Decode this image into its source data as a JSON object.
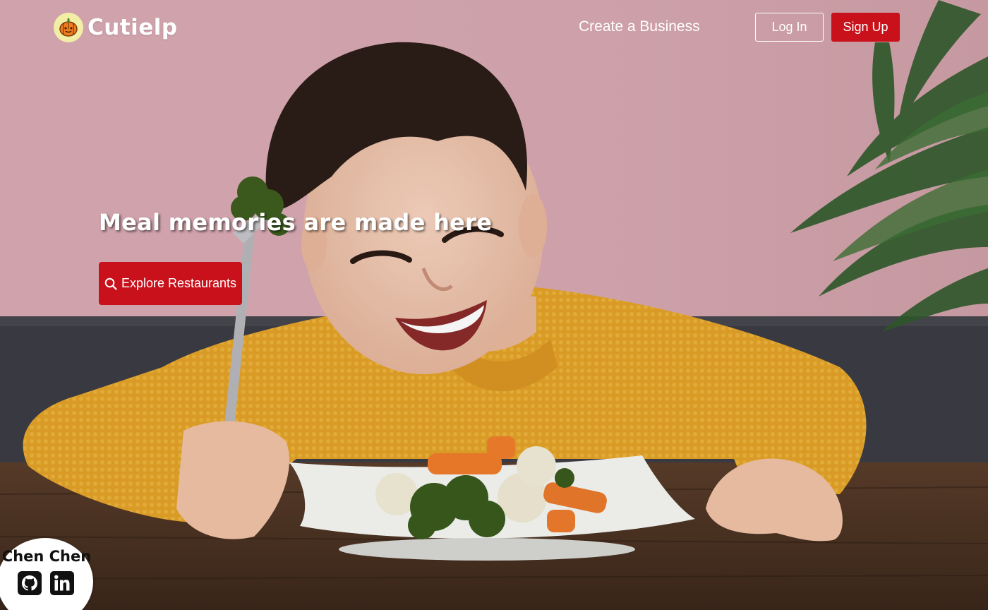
{
  "brand": {
    "name": "Cutielp",
    "logo_icon": "pumpkin-icon"
  },
  "nav": {
    "create_business": "Create a Business",
    "login": "Log In",
    "signup": "Sign Up"
  },
  "hero": {
    "headline": "Meal memories are made here",
    "cta_label": "Explore Restaurants",
    "cta_icon": "search-icon"
  },
  "developer": {
    "name": "Chen Chen",
    "links": [
      {
        "icon": "github-icon"
      },
      {
        "icon": "linkedin-icon"
      }
    ]
  },
  "colors": {
    "accent": "#c8111b",
    "wall": "#d6a9b2",
    "sweater": "#e6a62a",
    "table": "#4e3424"
  }
}
